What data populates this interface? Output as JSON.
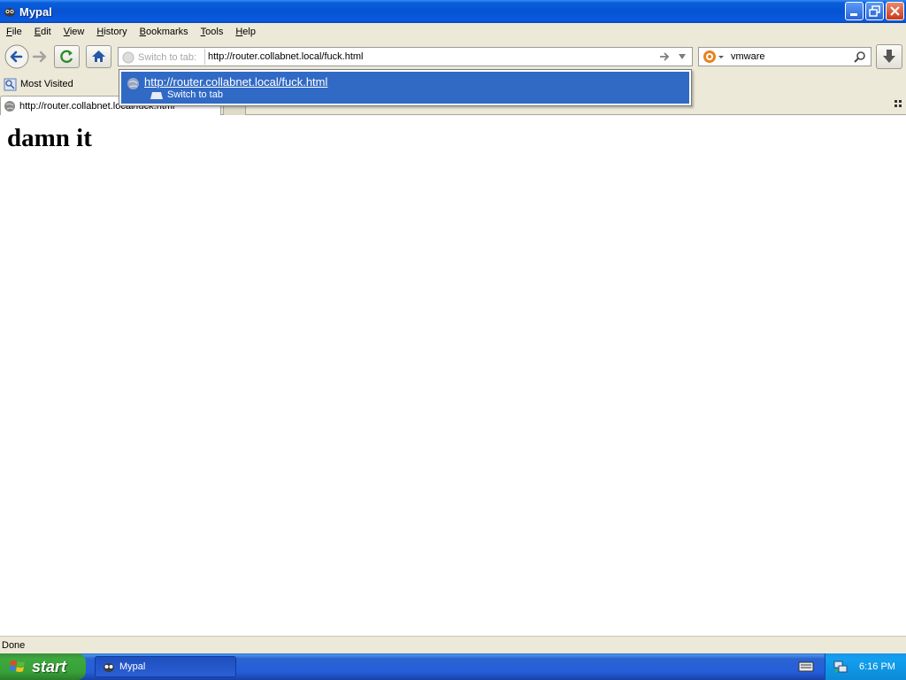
{
  "window": {
    "title": "Mypal"
  },
  "menu": [
    {
      "label": "File",
      "accel": "F",
      "rest": "ile"
    },
    {
      "label": "Edit",
      "accel": "E",
      "rest": "dit"
    },
    {
      "label": "View",
      "accel": "V",
      "rest": "iew"
    },
    {
      "label": "History",
      "accel": "H",
      "rest": "istory"
    },
    {
      "label": "Bookmarks",
      "accel": "B",
      "rest": "ookmarks"
    },
    {
      "label": "Tools",
      "accel": "T",
      "rest": "ools"
    },
    {
      "label": "Help",
      "accel": "H",
      "rest": "elp"
    }
  ],
  "urlbar": {
    "mode_label": "Switch to tab:",
    "value": "http://router.collabnet.local/fuck.html"
  },
  "search": {
    "value": "vmware"
  },
  "bookmarks": {
    "most_visited": "Most Visited"
  },
  "tabs": [
    {
      "title": "http://router.collabnet.local/fuck.html"
    }
  ],
  "autocomplete": {
    "url": "http://router.collabnet.local/fuck.html",
    "action": "Switch to tab"
  },
  "page": {
    "heading": "damn it"
  },
  "status": {
    "text": "Done"
  },
  "taskbar": {
    "start_label": "start",
    "window_item": "Mypal",
    "clock": "6:16 PM"
  },
  "colors": {
    "selection": "#316ac5",
    "chrome": "#ece9d8",
    "titlebar": "#0553d3"
  },
  "icons": [
    "app-icon",
    "minimize-icon",
    "restore-icon",
    "close-icon",
    "back-icon",
    "forward-icon",
    "reload-icon",
    "home-icon",
    "switch-tab-icon",
    "go-arrow-icon",
    "dropdown-arrow-icon",
    "search-engine-icon",
    "search-icon",
    "download-icon",
    "most-visited-icon",
    "globe-icon",
    "tab-list-icon",
    "windows-logo-icon",
    "keyboard-icon",
    "network-icon"
  ]
}
